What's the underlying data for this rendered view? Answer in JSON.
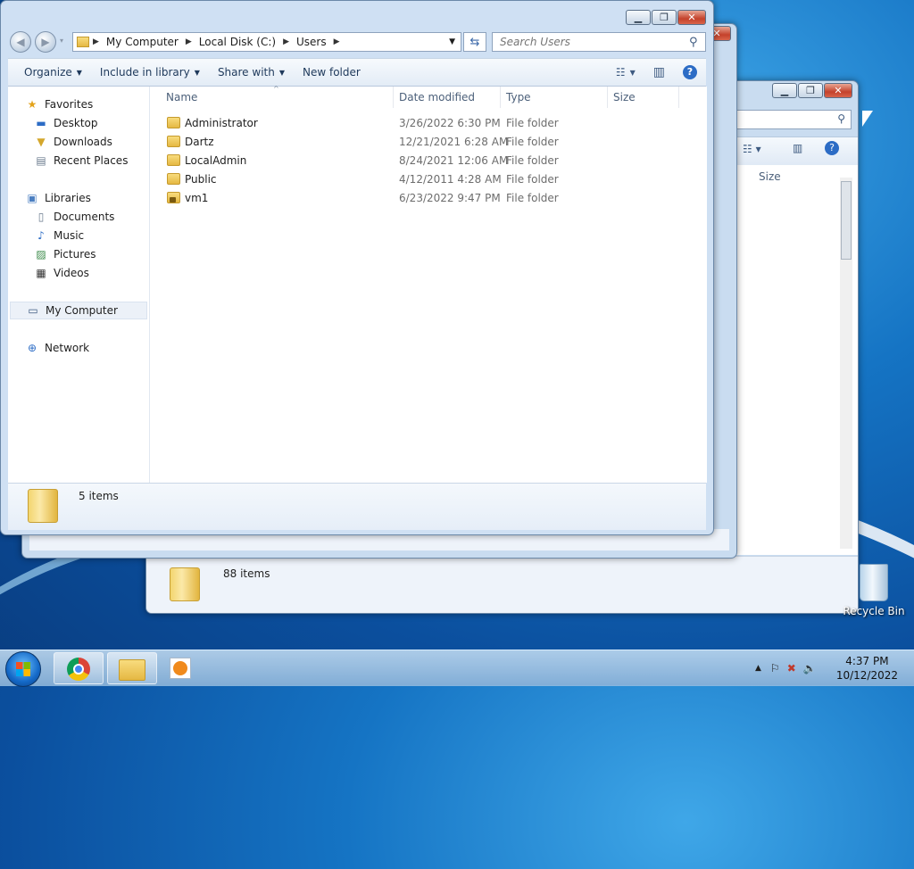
{
  "front_window": {
    "breadcrumbs": [
      "My Computer",
      "Local Disk (C:)",
      "Users"
    ],
    "search_placeholder": "Search Users",
    "toolbar": {
      "organize": "Organize",
      "include_in_library": "Include in library",
      "share_with": "Share with",
      "new_folder": "New folder"
    },
    "nav": {
      "favorites": "Favorites",
      "desktop": "Desktop",
      "downloads": "Downloads",
      "recent_places": "Recent Places",
      "libraries": "Libraries",
      "documents": "Documents",
      "music": "Music",
      "pictures": "Pictures",
      "videos": "Videos",
      "my_computer": "My Computer",
      "network": "Network"
    },
    "columns": {
      "name": "Name",
      "date_modified": "Date modified",
      "type": "Type",
      "size": "Size"
    },
    "files": [
      {
        "name": "Administrator",
        "date": "3/26/2022 6:30 PM",
        "type": "File folder",
        "size": ""
      },
      {
        "name": "Dartz",
        "date": "12/21/2021 6:28 AM",
        "type": "File folder",
        "size": ""
      },
      {
        "name": "LocalAdmin",
        "date": "8/24/2021 12:06 AM",
        "type": "File folder",
        "size": ""
      },
      {
        "name": "Public",
        "date": "4/12/2011 4:28 AM",
        "type": "File folder",
        "size": ""
      },
      {
        "name": "vm1",
        "date": "6/23/2022 9:47 PM",
        "type": "File folder",
        "size": ""
      }
    ],
    "status": "5 items"
  },
  "back_window": {
    "column_size": "Size",
    "status": "88 items"
  },
  "desktop": {
    "recycle_bin": "Recycle Bin"
  },
  "taskbar": {
    "time": "4:37 PM",
    "date": "10/12/2022"
  }
}
